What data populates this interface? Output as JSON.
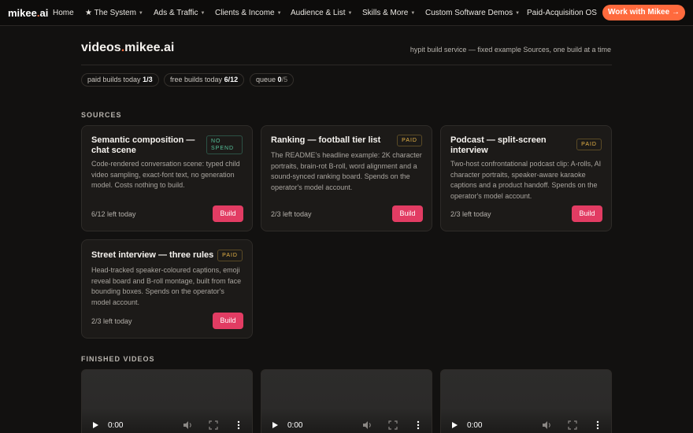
{
  "nav": {
    "logo_main": "mikee",
    "logo_dot": ".",
    "logo_tld": "ai",
    "items": [
      {
        "label": "Home"
      },
      {
        "label": "★ The System"
      },
      {
        "label": "Ads & Traffic"
      },
      {
        "label": "Clients & Income"
      },
      {
        "label": "Audience & List"
      },
      {
        "label": "Skills & More"
      },
      {
        "label": "Custom Software Demos"
      },
      {
        "label": "Paid-Acquisition OS"
      }
    ],
    "cta": "Work with Mikee →"
  },
  "header": {
    "title_main": "videos",
    "title_dot": ".",
    "title_rest": "mikee.ai",
    "subtitle": "hypit build service — fixed example Sources, one build at a time"
  },
  "stats": {
    "paid_label": "paid builds today",
    "paid_value": "1/3",
    "free_label": "free builds today",
    "free_value": "6/12",
    "queue_label": "queue",
    "queue_value": "0",
    "queue_total": "/5"
  },
  "sources": {
    "label": "SOURCES",
    "cards": [
      {
        "title": "Semantic composition — chat scene",
        "badge": "NO SPEND",
        "description": "Code-rendered conversation scene: typed child video sampling, exact-font text, no generation model. Costs nothing to build.",
        "left_today": "6/12 left today",
        "button": "Build"
      },
      {
        "title": "Ranking — football tier list",
        "badge": "PAID",
        "description": "The README's headline example: 2K character portraits, brain-rot B-roll, word alignment and a sound-synced ranking board. Spends on the operator's model account.",
        "left_today": "2/3 left today",
        "button": "Build"
      },
      {
        "title": "Podcast — split-screen interview",
        "badge": "PAID",
        "description": "Two-host confrontational podcast clip: A-rolls, AI character portraits, speaker-aware karaoke captions and a product handoff. Spends on the operator's model account.",
        "left_today": "2/3 left today",
        "button": "Build"
      },
      {
        "title": "Street interview — three rules",
        "badge": "PAID",
        "description": "Head-tracked speaker-coloured captions, emoji reveal board and B-roll montage, built from face bounding boxes. Spends on the operator's model account.",
        "left_today": "2/3 left today",
        "button": "Build"
      }
    ]
  },
  "finished": {
    "label": "FINISHED VIDEOS",
    "videos": [
      {
        "time": "0:00"
      },
      {
        "time": "0:00"
      },
      {
        "time": "0:00"
      }
    ]
  },
  "colors": {
    "accent": "#ff6a3d",
    "build": "#e23c63",
    "paid_badge": "#e6b347",
    "free_badge": "#56c29a"
  }
}
